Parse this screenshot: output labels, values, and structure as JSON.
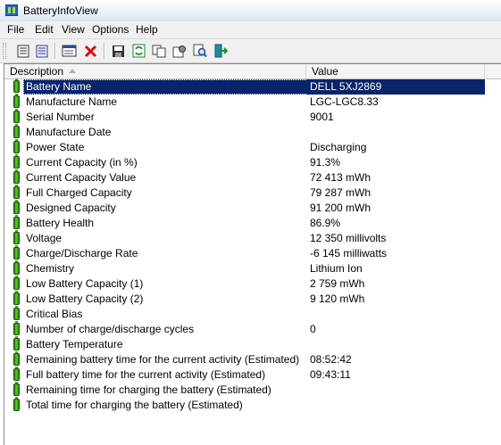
{
  "window": {
    "title": "BatteryInfoView"
  },
  "menu": [
    "File",
    "Edit",
    "View",
    "Options",
    "Help"
  ],
  "toolbar": {
    "icons": [
      "properties-icon",
      "list-view-icon",
      "html-report-icon",
      "delete-icon",
      "save-icon",
      "refresh-icon",
      "copy-icon",
      "settings-icon",
      "find-icon",
      "exit-icon"
    ]
  },
  "columns": {
    "description": "Description",
    "value": "Value"
  },
  "rows": [
    {
      "label": "Battery Name",
      "value": "DELL 5XJ2869",
      "selected": true
    },
    {
      "label": "Manufacture Name",
      "value": "LGC-LGC8.33"
    },
    {
      "label": "Serial Number",
      "value": "9001"
    },
    {
      "label": "Manufacture Date",
      "value": ""
    },
    {
      "label": "Power State",
      "value": "Discharging"
    },
    {
      "label": "Current Capacity (in %)",
      "value": "91.3%"
    },
    {
      "label": "Current Capacity Value",
      "value": "72 413 mWh"
    },
    {
      "label": "Full Charged Capacity",
      "value": "79 287 mWh"
    },
    {
      "label": "Designed Capacity",
      "value": "91 200 mWh"
    },
    {
      "label": "Battery Health",
      "value": "86.9%"
    },
    {
      "label": "Voltage",
      "value": "12 350 millivolts"
    },
    {
      "label": "Charge/Discharge Rate",
      "value": "-6 145 milliwatts"
    },
    {
      "label": "Chemistry",
      "value": "Lithium Ion"
    },
    {
      "label": "Low Battery Capacity (1)",
      "value": "2 759 mWh"
    },
    {
      "label": "Low Battery Capacity (2)",
      "value": "9 120 mWh"
    },
    {
      "label": "Critical Bias",
      "value": ""
    },
    {
      "label": "Number of charge/discharge cycles",
      "value": "0"
    },
    {
      "label": "Battery Temperature",
      "value": ""
    },
    {
      "label": "Remaining battery time for the current activity (Estimated)",
      "value": "08:52:42"
    },
    {
      "label": "Full battery time for the current activity (Estimated)",
      "value": "09:43:11"
    },
    {
      "label": "Remaining time for charging the battery (Estimated)",
      "value": ""
    },
    {
      "label": "Total  time for charging the battery (Estimated)",
      "value": ""
    }
  ]
}
